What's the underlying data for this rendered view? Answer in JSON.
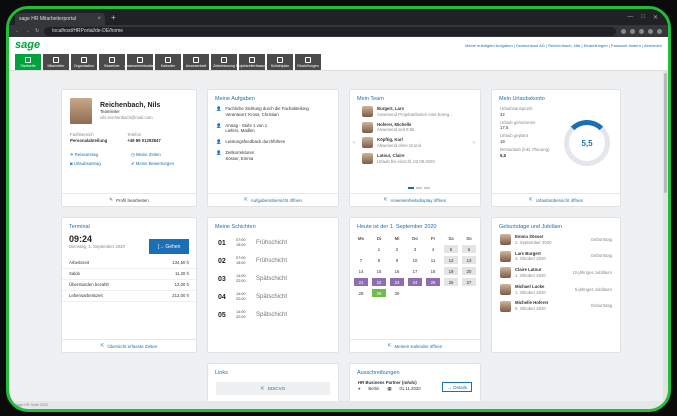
{
  "browser": {
    "tab_title": "sage HR Mitarbeiterportal",
    "tab_close": "×",
    "new_tab": "+",
    "url": "localhost/HRPortal/de-DE/home"
  },
  "header": {
    "logo": "sage",
    "links": "Meine erledigten Aufgaben | Deutschland AG | Reichenbach, Nils | Einstellungen | Passwort ändern | Abmelden"
  },
  "nav": [
    {
      "label": "Startseite"
    },
    {
      "label": "Mitarbeiter"
    },
    {
      "label": "Organisation"
    },
    {
      "label": "Bewerber"
    },
    {
      "label": "Anwesenheitsdaten"
    },
    {
      "label": "Kalender"
    },
    {
      "label": "Anwesenheit"
    },
    {
      "label": "Zeiterfassung"
    },
    {
      "label": "Projektzeiterfassung"
    },
    {
      "label": "Schichtplan"
    },
    {
      "label": "Einstellungen"
    }
  ],
  "profile": {
    "name": "Reichenbach, Nils",
    "role": "Teamleiter",
    "email": "nils.reichenbach@mail.com",
    "dept_label": "Fachbereich",
    "dept_value": "Personalabteilung",
    "phone_label": "Telefon",
    "phone_value": "+49 89 01293847",
    "links": [
      "Reiseantrag",
      "Meine Zeiten",
      "Urlaubsantrag",
      "Meine Bewertungen"
    ],
    "footer": "Profil bearbeiten"
  },
  "tasks": {
    "title": "Meine Aufgaben",
    "items": [
      {
        "l1": "Fachliche Sichtung durch die Fachabteilung",
        "l2": "Verantwort: Kross, Christian"
      },
      {
        "l1": "Antrag - Stufe 1 von 1",
        "l2": "Liefers, Madlen"
      },
      {
        "l1": "Leistungsfeedback durchführen",
        "l2": ""
      },
      {
        "l1": "Zeitkorrekturen",
        "l2": "Sösser, Emma"
      }
    ],
    "footer": "Aufgabenübersicht öffnen"
  },
  "team": {
    "title": "Mein Team",
    "members": [
      {
        "name": "Burgert, Lars",
        "status": "Anwesend Projektarbeiten eine Energ..."
      },
      {
        "name": "Hoferer, Michelle",
        "status": "Anwesend seit 8:55"
      },
      {
        "name": "Köpftig, Karl",
        "status": "Abwesend ohne Grund"
      },
      {
        "name": "Latour, Claire",
        "status": "Urlaub bis einschl. 02.09.2020"
      }
    ],
    "footer": "Anwesenheitsdisplay öffnen"
  },
  "vacation": {
    "title": "Mein Urlaubskonto",
    "rows": [
      {
        "label": "Urlaubsanspruch",
        "value": "42"
      },
      {
        "label": "Urlaub genommen",
        "value": "17,5"
      },
      {
        "label": "Urlaub geplant",
        "value": "19"
      },
      {
        "label": "Resturlaub (inkl. Planung)",
        "value": "5,5"
      }
    ],
    "ring_value": "5,5",
    "ring_fraction": 0.13,
    "footer": "Urlaubsübersicht öffnen"
  },
  "terminal": {
    "title": "Terminal",
    "time": "09:24",
    "date": "Dienstag, 1. September 2020",
    "button": "Gehen",
    "rows": [
      {
        "label": "Arbeitszeit",
        "value": "134,50 h"
      },
      {
        "label": "Saldo",
        "value": "11,20 h"
      },
      {
        "label": "Überstunden bezahlt",
        "value": "12,00 h"
      },
      {
        "label": "Lebensarbeitszeit",
        "value": "212,00 h"
      }
    ],
    "footer": "Übersicht erfasste Zeiten"
  },
  "shifts": {
    "title": "Meine Schichten",
    "items": [
      {
        "day": "01",
        "from": "07:00",
        "to": "15:00",
        "name": "Frühschicht"
      },
      {
        "day": "02",
        "from": "07:00",
        "to": "15:00",
        "name": "Frühschicht"
      },
      {
        "day": "03",
        "from": "14:00",
        "to": "22:00",
        "name": "Spätschicht"
      },
      {
        "day": "04",
        "from": "14:00",
        "to": "22:00",
        "name": "Spätschicht"
      },
      {
        "day": "05",
        "from": "14:00",
        "to": "22:00",
        "name": "Spätschicht"
      }
    ]
  },
  "calendar": {
    "title": "Heute ist der 1. September 2020",
    "weekdays": [
      "Mo",
      "Di",
      "Mi",
      "Do",
      "Fr",
      "Sa",
      "So"
    ],
    "footer": "Meinen Kalender öffnen"
  },
  "birthdays": {
    "title": "Geburtstage und Jubiläen",
    "items": [
      {
        "name": "Emma Sösser",
        "date": "2. September 2020",
        "type": "Geburtstag"
      },
      {
        "name": "Lars Burgert",
        "date": "3. Oktober 2020",
        "type": "Geburtstag"
      },
      {
        "name": "Claire Latour",
        "date": "1. Oktober 2020",
        "type": "10-jähriges Jubiläum"
      },
      {
        "name": "Michael Lucke",
        "date": "1. Oktober 2020",
        "type": "5-jähriges Jubiläum"
      },
      {
        "name": "Michelle Hoferer",
        "date": "5. Oktober 2020",
        "type": "Geburtstag"
      }
    ]
  },
  "links": {
    "title": "Links",
    "item": "DISCVO"
  },
  "jobs": {
    "title": "Ausschreibungen",
    "position": "HR Business Partner (m/w/x)",
    "location": "Berlin",
    "date": "01.11.2020",
    "button": "Details"
  },
  "status_bar": "Sage HR Suite 2020",
  "colors": {
    "brand": "#00a23c",
    "accent": "#1a6fb5",
    "vacation": "#8e6db0",
    "today": "#6cbd4a",
    "frame": "#1fbf3a"
  }
}
